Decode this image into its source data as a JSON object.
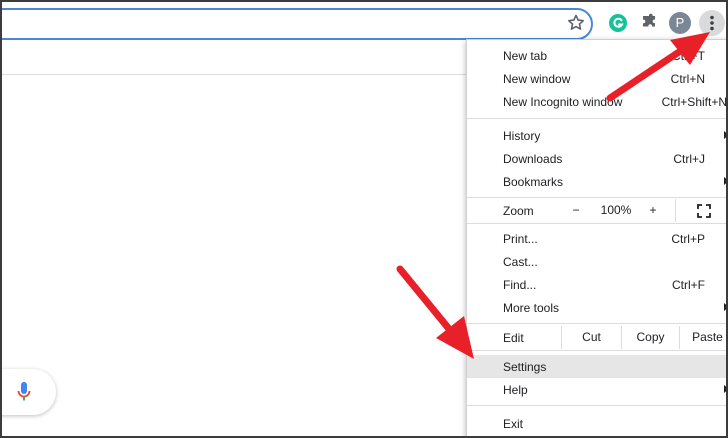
{
  "toolbar": {
    "avatar_letter": "P",
    "icons": [
      "star-icon",
      "grammarly-icon",
      "extensions-icon",
      "more-menu-icon"
    ]
  },
  "menu": {
    "new_tab": {
      "label": "New tab",
      "shortcut": "Ctrl+T"
    },
    "new_window": {
      "label": "New window",
      "shortcut": "Ctrl+N"
    },
    "new_incognito": {
      "label": "New Incognito window",
      "shortcut": "Ctrl+Shift+N"
    },
    "history": {
      "label": "History"
    },
    "downloads": {
      "label": "Downloads",
      "shortcut": "Ctrl+J"
    },
    "bookmarks": {
      "label": "Bookmarks"
    },
    "zoom": {
      "label": "Zoom",
      "minus": "−",
      "value": "100%",
      "plus": "+"
    },
    "print": {
      "label": "Print...",
      "shortcut": "Ctrl+P"
    },
    "cast": {
      "label": "Cast..."
    },
    "find": {
      "label": "Find...",
      "shortcut": "Ctrl+F"
    },
    "more_tools": {
      "label": "More tools"
    },
    "edit": {
      "label": "Edit",
      "cut": "Cut",
      "copy": "Copy",
      "paste": "Paste"
    },
    "settings": {
      "label": "Settings"
    },
    "help": {
      "label": "Help"
    },
    "exit": {
      "label": "Exit"
    }
  },
  "colors": {
    "accent_blue": "#4a87d6",
    "annotation_red": "#e8202a",
    "highlight": "#e6e6e6"
  }
}
